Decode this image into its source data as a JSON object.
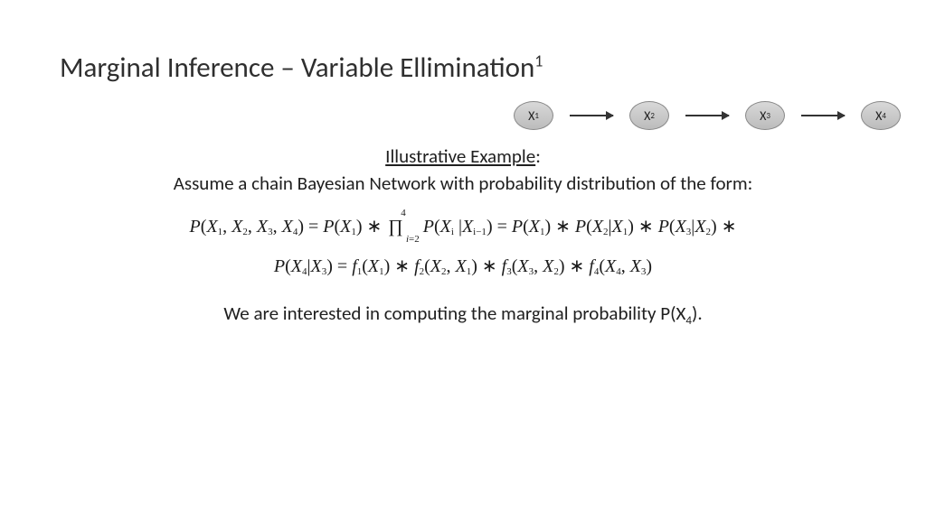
{
  "title": {
    "main": "Marginal Inference – Variable Ellimination",
    "sup": "1"
  },
  "diagram": {
    "nodes": [
      "X",
      "X",
      "X",
      "X"
    ],
    "subs": [
      "1",
      "2",
      "3",
      "4"
    ]
  },
  "illustrative": {
    "label": "Illustrative Example",
    "colon": ":"
  },
  "assume": "Assume a chain Bayesian Network with probability distribution of the form:",
  "formula1": {
    "p1": "P",
    "lp1": "(",
    "x1": "X",
    "s1": "1",
    "c1": ", ",
    "x2": "X",
    "s2": "2",
    "c2": ", ",
    "x3": "X",
    "s3": "3",
    "c3": ", ",
    "x4": "X",
    "s4": "4",
    "rp1": ") = ",
    "px1": "P",
    "lpx1": "(",
    "xx1": "X",
    "sx1": "1",
    "rpx1": ") ∗ ",
    "prod": "∏",
    "psup": "4",
    "psub_i": "i",
    "psub_eq": "=2",
    "spacer": " ",
    "pxi": "P",
    "lpxi": "(",
    "xi": "X",
    "si": "i",
    "bar1": " |",
    "xim": "X",
    "sim": "i−1",
    "rpxi": ") = ",
    "p2x1": "P",
    "lp2x1": "(",
    "x2x1": "X",
    "s2x1": "1",
    "rp2x1": ") ∗ ",
    "p2x2": "P",
    "lp2x2": "(",
    "x2x2": "X",
    "s2x2": "2",
    "bar2": "|",
    "x2x1b": "X",
    "s2x1b": "1",
    "rp2x2": ") ∗ ",
    "p2x3": "P",
    "lp2x3": "(",
    "x2x3": "X",
    "s2x3": "3",
    "bar3": "|",
    "x2x2b": "X",
    "s2x2b": "2",
    "rp2x3": ") ∗"
  },
  "formula2": {
    "px4": "P",
    "lpx4": "(",
    "x4": "X",
    "s4": "4",
    "bar4": "|",
    "x3b": "X",
    "s3b": "3",
    "rpx4": ") = ",
    "f1": "f",
    "fs1": "1",
    "lp_f1": "(",
    "fx1": "X",
    "fsx1": "1",
    "rp_f1": ") ∗ ",
    "f2": "f",
    "fs2": "2",
    "lp_f2": "(",
    "fx2a": "X",
    "fsx2a": "2",
    "cf2": ", ",
    "fx2b": "X",
    "fsx2b": "1",
    "rp_f2": ") ∗ ",
    "f3": "f",
    "fs3": "3",
    "lp_f3": "(",
    "fx3a": "X",
    "fsx3a": "3",
    "cf3": ", ",
    "fx3b": "X",
    "fsx3b": "2",
    "rp_f3": ") ∗ ",
    "f4": "f",
    "fs4": "4",
    "lp_f4": "(",
    "fx4a": "X",
    "fsx4a": "4",
    "cf4": ", ",
    "fx4b": "X",
    "fsx4b": "3",
    "rp_f4": ")"
  },
  "marginal": {
    "pre": "We are interested in computing the marginal probability P(X",
    "sub": "4",
    "post": ")."
  }
}
